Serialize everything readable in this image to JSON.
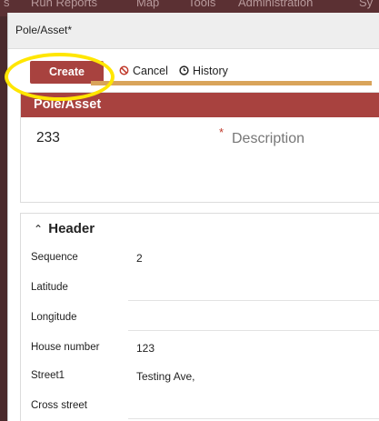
{
  "topnav": {
    "items": [
      "s",
      "Run Reports",
      "Map",
      "Tools",
      "Administration",
      "Sy"
    ]
  },
  "window": {
    "title": "Pole/Asset*"
  },
  "toolbar": {
    "create_label": "Create",
    "cancel_label": "Cancel",
    "history_label": "History"
  },
  "pole_panel": {
    "heading": "Pole/Asset",
    "pole_id": "233",
    "required_mark": "*",
    "description_placeholder": "Description"
  },
  "header_section": {
    "toggle_label": "Header",
    "fields": [
      {
        "label": "Sequence",
        "value": "2"
      },
      {
        "label": "Latitude",
        "value": ""
      },
      {
        "label": "Longitude",
        "value": ""
      },
      {
        "label": "House number",
        "value": "123"
      },
      {
        "label": "Street1",
        "value": "Testing Ave,"
      },
      {
        "label": "Cross street",
        "value": ""
      }
    ]
  },
  "colors": {
    "accent": "#a8423f",
    "highlight": "#ffe600",
    "divider": "#d9a45a"
  }
}
